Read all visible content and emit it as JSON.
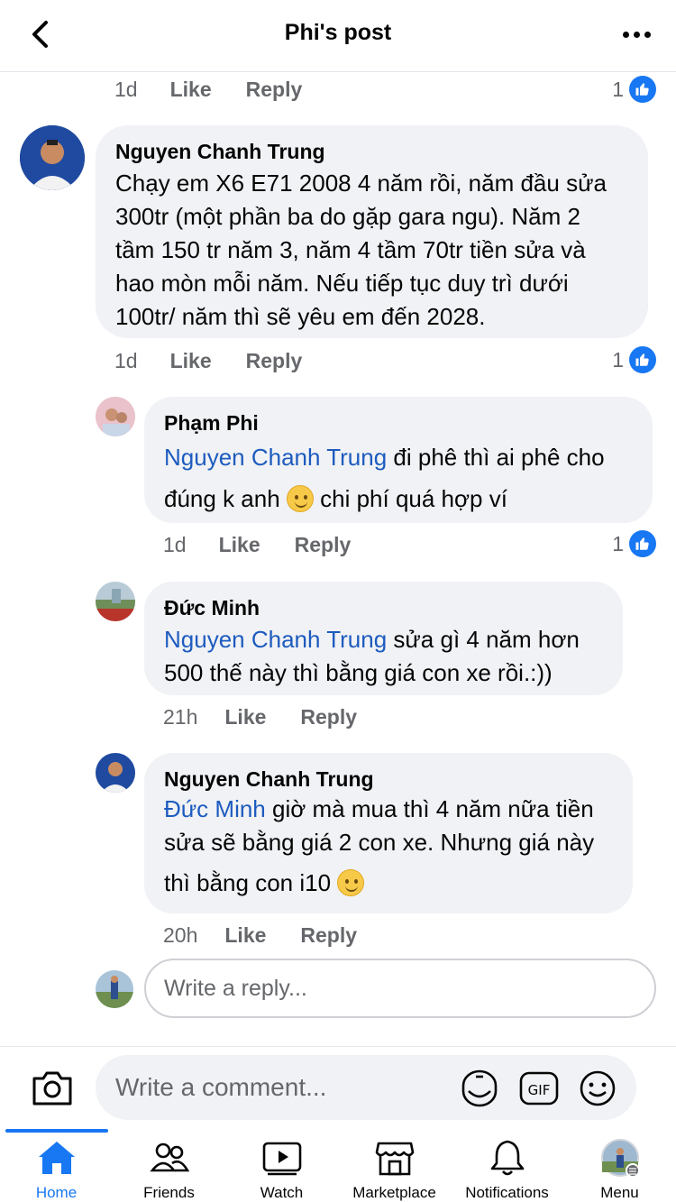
{
  "header": {
    "title": "Phi's post"
  },
  "top_meta": {
    "time": "1d",
    "like": "Like",
    "reply": "Reply",
    "reactions": "1"
  },
  "comments": [
    {
      "author": "Nguyen Chanh Trung",
      "lines": [
        "Chạy em X6 E71 2008 4 năm rồi, năm đầu sửa",
        "300tr (một phần ba do gặp gara ngu). Năm 2",
        "tầm 150 tr năm 3, năm 4 tầm 70tr tiền sửa và",
        "hao mòn mỗi năm. Nếu tiếp tục  duy trì dưới",
        "100tr/ năm thì sẽ yêu em đến 2028."
      ],
      "time": "1d",
      "like": "Like",
      "reply": "Reply",
      "reactions": "1"
    },
    {
      "author": "Phạm Phi",
      "mention": "Nguyen Chanh Trung",
      "line1_rest": " đi phê thì ai phê cho",
      "line2a": "đúng k anh ",
      "line2b": " chi phí quá hợp ví",
      "time": "1d",
      "like": "Like",
      "reply": "Reply",
      "reactions": "1"
    },
    {
      "author": "Đức Minh",
      "mention": "Nguyen Chanh Trung",
      "line1_rest": "  sửa gì 4 năm hơn",
      "line2": "500 thế này thì bằng giá con xe rồi.:))",
      "time": "21h",
      "like": "Like",
      "reply": "Reply"
    },
    {
      "author": "Nguyen Chanh Trung",
      "mention": "Đức Minh",
      "line1_rest": " giờ mà mua thì 4 năm nữa tiền",
      "line2": "sửa sẽ bằng giá 2 con xe. Nhưng giá này",
      "line3": "thì bằng con i10 ",
      "time": "20h",
      "like": "Like",
      "reply": "Reply"
    }
  ],
  "reply_box": {
    "placeholder": "Write a reply..."
  },
  "composer": {
    "placeholder": "Write a comment...",
    "gif_label": "GIF"
  },
  "nav": [
    {
      "label": "Home",
      "icon": "home-icon",
      "active": true
    },
    {
      "label": "Friends",
      "icon": "friends-icon"
    },
    {
      "label": "Watch",
      "icon": "watch-icon"
    },
    {
      "label": "Marketplace",
      "icon": "marketplace-icon"
    },
    {
      "label": "Notifications",
      "icon": "bell-icon"
    },
    {
      "label": "Menu",
      "icon": "menu-icon"
    }
  ],
  "colors": {
    "accent": "#1877f2",
    "mention": "#1d5bbf",
    "bubble": "#f0f2f5",
    "meta": "#65676b"
  }
}
